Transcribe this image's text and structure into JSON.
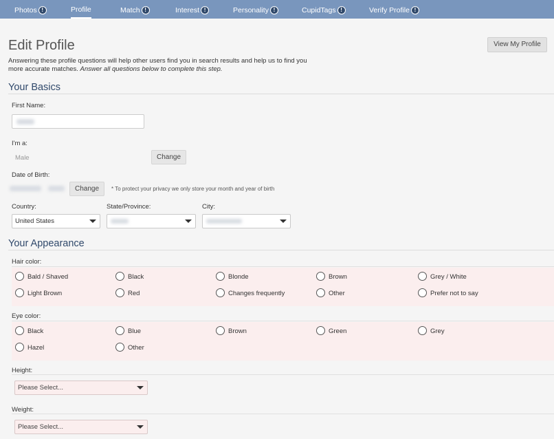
{
  "nav": [
    {
      "label": "Photos",
      "badge": "!",
      "active": false
    },
    {
      "label": "Profile",
      "badge": "",
      "active": true
    },
    {
      "label": "Match",
      "badge": "!",
      "active": false
    },
    {
      "label": "Interest",
      "badge": "!",
      "active": false
    },
    {
      "label": "Personality",
      "badge": "!",
      "active": false
    },
    {
      "label": "CupidTags",
      "badge": "!",
      "active": false
    },
    {
      "label": "Verify Profile",
      "badge": "!",
      "active": false
    }
  ],
  "header": {
    "title": "Edit Profile",
    "view_button": "View My Profile",
    "intro_text": "Answering these profile questions will help other users find you in search results and help us to find you more accurate matches.",
    "intro_emphasis": "Answer all questions below to complete this step."
  },
  "basics": {
    "title": "Your Basics",
    "first_name_label": "First Name:",
    "im_a_label": "I'm a:",
    "gender_value": "Male",
    "gender_change": "Change",
    "dob_label": "Date of Birth:",
    "dob_change": "Change",
    "dob_note": "* To protect your privacy we only store your month and year of birth",
    "country_label": "Country:",
    "country_value": "United States",
    "state_label": "State/Province:",
    "city_label": "City:"
  },
  "appearance": {
    "title": "Your Appearance",
    "hair_label": "Hair color:",
    "hair_options": [
      "Bald / Shaved",
      "Black",
      "Blonde",
      "Brown",
      "Grey / White",
      "Light Brown",
      "Red",
      "Changes frequently",
      "Other",
      "Prefer not to say"
    ],
    "eye_label": "Eye color:",
    "eye_options": [
      "Black",
      "Blue",
      "Brown",
      "Green",
      "Grey",
      "Hazel",
      "Other"
    ],
    "height_label": "Height:",
    "height_value": "Please Select...",
    "weight_label": "Weight:",
    "weight_value": "Please Select..."
  },
  "colors": {
    "nav_bg": "#7996bd",
    "section_title": "#30496b",
    "radio_panel_bg": "#fbeeee"
  }
}
